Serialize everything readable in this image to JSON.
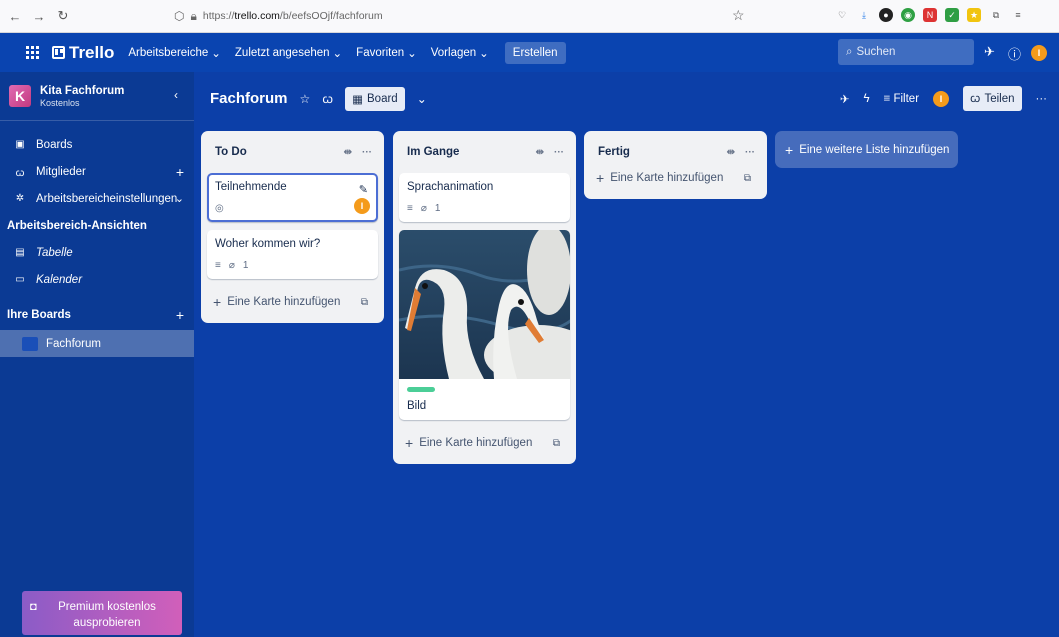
{
  "browser": {
    "url_prefix": "https://",
    "url_host": "trello.com",
    "url_path": "/b/eefsOOjf/fachforum"
  },
  "header": {
    "logo": "Trello",
    "nav": [
      {
        "label": "Arbeitsbereiche"
      },
      {
        "label": "Zuletzt angesehen"
      },
      {
        "label": "Favoriten"
      },
      {
        "label": "Vorlagen"
      }
    ],
    "create_label": "Erstellen",
    "search_placeholder": "Suchen",
    "avatar_initial": "I"
  },
  "sidebar": {
    "workspace_initial": "K",
    "workspace_name": "Kita Fachforum",
    "workspace_plan": "Kostenlos",
    "items": [
      {
        "label": "Boards"
      },
      {
        "label": "Mitglieder"
      },
      {
        "label": "Arbeitsbereicheinstellungen"
      }
    ],
    "views_heading": "Arbeitsbereich-Ansichten",
    "views": [
      {
        "label": "Tabelle"
      },
      {
        "label": "Kalender"
      }
    ],
    "boards_heading": "Ihre Boards",
    "boards": [
      {
        "label": "Fachforum"
      }
    ],
    "premium_label": "Premium kostenlos ausprobieren"
  },
  "board": {
    "title": "Fachforum",
    "view_label": "Board",
    "filter_label": "Filter",
    "share_label": "Teilen",
    "member_initial": "I"
  },
  "lists": [
    {
      "title": "To Do",
      "cards": [
        {
          "title": "Teilnehmende",
          "member": "I"
        },
        {
          "title": "Woher kommen wir?",
          "attachments": "1"
        }
      ],
      "add_card_label": "Eine Karte hinzufügen"
    },
    {
      "title": "Im Gange",
      "cards": [
        {
          "title": "Sprachanimation",
          "attachments": "1"
        },
        {
          "title": "Bild",
          "label_color": "#4bce97"
        }
      ],
      "add_card_label": "Eine Karte hinzufügen"
    },
    {
      "title": "Fertig",
      "cards": [],
      "add_card_label": "Eine Karte hinzufügen"
    }
  ],
  "add_list_label": "Eine weitere Liste hinzufügen",
  "colors": {
    "board_bg": "#0c3fa8",
    "header_bg": "#0a44b0",
    "sidebar_bg": "#0b3a94",
    "avatar_orange": "#f49b1b"
  }
}
